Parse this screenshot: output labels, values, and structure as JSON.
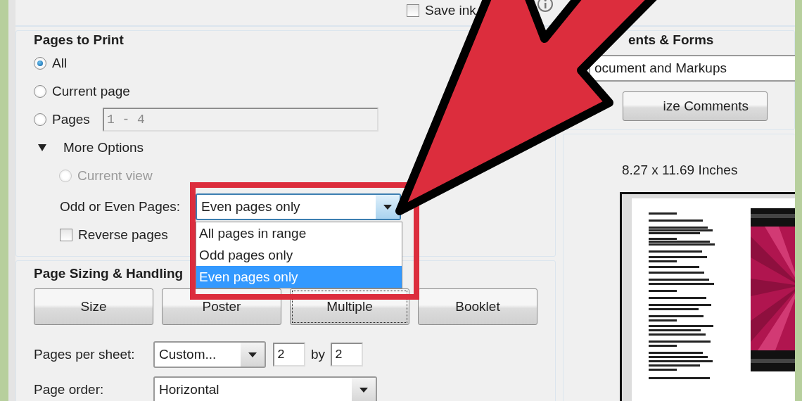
{
  "top": {
    "save_ink": {
      "label": "Save ink",
      "checked": false
    }
  },
  "pages_to_print": {
    "title": "Pages to Print",
    "options": [
      {
        "label": "All",
        "selected": true
      },
      {
        "label": "Current page",
        "selected": false
      },
      {
        "label": "Pages",
        "selected": false
      }
    ],
    "pages_field": {
      "value": "1 - 4",
      "disabled": true
    },
    "more_options": {
      "label": "More Options",
      "expanded": true,
      "current_view": {
        "label": "Current view",
        "selected": false,
        "disabled": true
      },
      "odd_even": {
        "label": "Odd or Even Pages:",
        "value": "Even pages only",
        "open": true,
        "options": [
          {
            "label": "All pages in range",
            "selected": false
          },
          {
            "label": "Odd pages only",
            "selected": false
          },
          {
            "label": "Even pages only",
            "selected": true
          }
        ]
      },
      "reverse": {
        "label": "Reverse pages",
        "checked": false
      }
    }
  },
  "page_sizing": {
    "title": "Page Sizing & Handling",
    "modes": [
      {
        "label": "Size",
        "selected": false
      },
      {
        "label": "Poster",
        "selected": false
      },
      {
        "label": "Multiple",
        "selected": true
      },
      {
        "label": "Booklet",
        "selected": false
      }
    ],
    "pages_per_sheet": {
      "label": "Pages per sheet:",
      "value": "Custom...",
      "columns": "2",
      "by": "by",
      "rows": "2"
    },
    "page_order": {
      "label": "Page order:",
      "value": "Horizontal"
    }
  },
  "comments_forms": {
    "title": "ents & Forms",
    "value": "ocument and Markups",
    "button": "ize Comments"
  },
  "preview": {
    "size": "8.27 x 11.69 Inches"
  }
}
